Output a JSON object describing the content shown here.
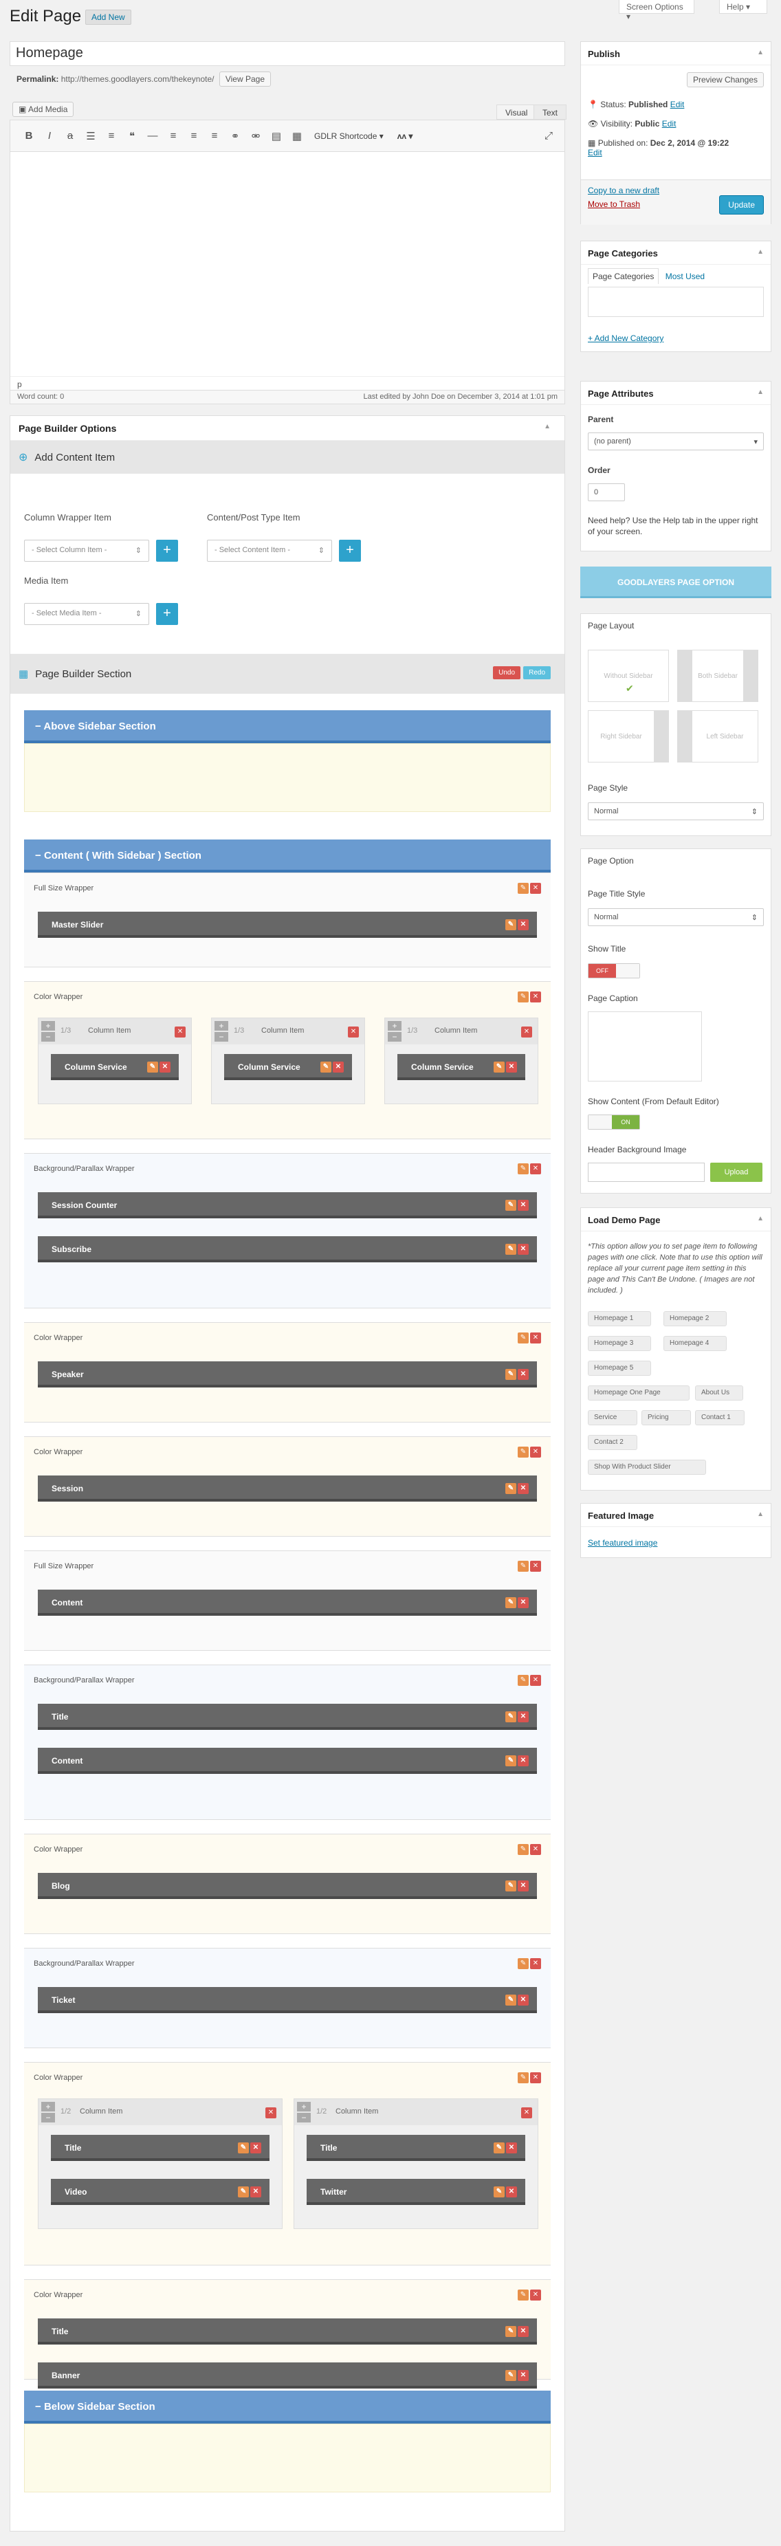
{
  "header": {
    "screen_options": "Screen Options ▾",
    "help": "Help ▾",
    "page_title": "Edit Page",
    "add_new": "Add New"
  },
  "post": {
    "title": "Homepage",
    "permalink_label": "Permalink:",
    "permalink_url": "http://themes.goodlayers.com/thekeynote/",
    "view_page": "View Page"
  },
  "editor": {
    "add_media": "Add Media",
    "tab_visual": "Visual",
    "tab_text": "Text",
    "shortcode": "GDLR Shortcode ▾",
    "path": "p",
    "word_count": "Word count: 0",
    "last_edited": "Last edited by John Doe on December 3, 2014 at 1:01 pm"
  },
  "page_builder": {
    "title": "Page Builder Options",
    "add_content_item": "Add Content Item",
    "column_wrapper_label": "Column Wrapper Item",
    "column_select": "- Select Column Item -",
    "content_label": "Content/Post Type Item",
    "content_select": "- Select Content Item -",
    "media_label": "Media Item",
    "media_select": "- Select Media Item -",
    "section_title": "Page Builder Section",
    "undo": "Undo",
    "redo": "Redo",
    "above_section": "Above Sidebar Section",
    "content_section": "Content ( With Sidebar ) Section",
    "below_section": "Below Sidebar Section",
    "wrappers": [
      {
        "title": "Full Size Wrapper",
        "items": [
          "Master Slider"
        ]
      },
      {
        "title": "Color Wrapper",
        "columns": [
          {
            "fraction": "1/3",
            "label": "Column Item",
            "items": [
              "Column Service"
            ]
          },
          {
            "fraction": "1/3",
            "label": "Column Item",
            "items": [
              "Column Service"
            ]
          },
          {
            "fraction": "1/3",
            "label": "Column Item",
            "items": [
              "Column Service"
            ]
          }
        ]
      },
      {
        "title": "Background/Parallax Wrapper",
        "items": [
          "Session Counter",
          "Subscribe"
        ]
      },
      {
        "title": "Color Wrapper",
        "items": [
          "Speaker"
        ]
      },
      {
        "title": "Color Wrapper",
        "items": [
          "Session"
        ]
      },
      {
        "title": "Full Size Wrapper",
        "items": [
          "Content"
        ]
      },
      {
        "title": "Background/Parallax Wrapper",
        "items": [
          "Title",
          "Content"
        ]
      },
      {
        "title": "Color Wrapper",
        "items": [
          "Blog"
        ]
      },
      {
        "title": "Background/Parallax Wrapper",
        "items": [
          "Ticket"
        ]
      },
      {
        "title": "Color Wrapper",
        "columns": [
          {
            "fraction": "1/2",
            "label": "Column Item",
            "items": [
              "Title",
              "Video"
            ]
          },
          {
            "fraction": "1/2",
            "label": "Column Item",
            "items": [
              "Title",
              "Twitter"
            ]
          }
        ]
      },
      {
        "title": "Color Wrapper",
        "items": [
          "Title",
          "Banner"
        ]
      }
    ]
  },
  "publish": {
    "title": "Publish",
    "preview": "Preview Changes",
    "status_label": "Status:",
    "status": "Published",
    "visibility_label": "Visibility:",
    "visibility": "Public",
    "published_label": "Published on:",
    "published_date": "Dec 2, 2014 @ 19:22",
    "edit": "Edit",
    "copy_draft": "Copy to a new draft",
    "trash": "Move to Trash",
    "update": "Update"
  },
  "categories": {
    "title": "Page Categories",
    "tab_all": "Page Categories",
    "tab_used": "Most Used",
    "add_new": "+ Add New Category"
  },
  "attributes": {
    "title": "Page Attributes",
    "parent_label": "Parent",
    "parent_value": "(no parent)",
    "order_label": "Order",
    "order_value": "0",
    "help": "Need help? Use the Help tab in the upper right of your screen."
  },
  "goodlayers": {
    "banner": "GOODLAYERS PAGE OPTION",
    "layout_label": "Page Layout",
    "layouts": [
      "Without Sidebar",
      "Both Sidebar",
      "Right Sidebar",
      "Left Sidebar"
    ],
    "style_label": "Page Style",
    "style_value": "Normal"
  },
  "page_option": {
    "title": "Page Option",
    "title_style_label": "Page Title Style",
    "title_style_value": "Normal",
    "show_title_label": "Show Title",
    "off": "OFF",
    "caption_label": "Page Caption",
    "show_content_label": "Show Content (From Default Editor)",
    "on": "ON",
    "header_bg_label": "Header Background Image",
    "upload": "Upload"
  },
  "demo": {
    "title": "Load Demo Page",
    "note": "*This option allow you to set page item to following pages with one click. Note that to use this option will replace all your current page item setting in this page and This Can't Be Undone. ( Images are not included. )",
    "buttons": [
      "Homepage 1",
      "Homepage 2",
      "Homepage 3",
      "Homepage 4",
      "Homepage 5",
      "Homepage One Page",
      "About Us",
      "Service",
      "Pricing",
      "Contact 1",
      "Contact 2",
      "Shop With Product Slider"
    ]
  },
  "featured": {
    "title": "Featured Image",
    "link": "Set featured image"
  },
  "colors": {
    "accent": "#2ea2cc",
    "section_blue": "#6a9bd0",
    "item_gray": "#676767",
    "undo": "#d9534f",
    "redo": "#5bc0de",
    "banner": "#8ccde6"
  }
}
